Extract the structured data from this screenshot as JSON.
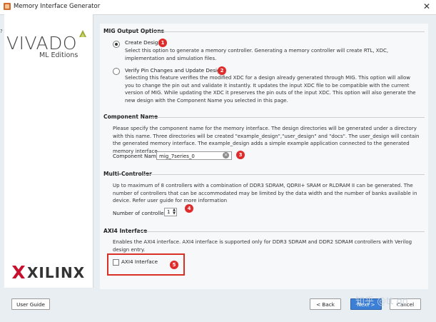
{
  "window": {
    "title": "Memory Interface Generator",
    "close_glyph": "✕"
  },
  "branding": {
    "vivado_word": "VIVADO",
    "ml_editions": "ML Editions",
    "xilinx_word": "XILINX"
  },
  "mig_output": {
    "heading": "MIG Output Options",
    "create": {
      "label": "Create Design",
      "description": "Select this option to generate a memory controller. Generating a memory controller will create RTL, XDC, implementation and simulation files.",
      "selected": true,
      "badge": "1"
    },
    "verify": {
      "label": "Verify Pin Changes and Update Design",
      "description": "Selecting this feature verifies the modified XDC for a design already generated through MIG. This option will allow you to change the pin out and validate it instantly. It updates the input XDC file to be compatible with the current version of MIG. While updating the XDC it preserves the pin outs of the input XDC. This option will also generate the new design with the Component Name you selected in this page.",
      "selected": false,
      "badge": "2"
    }
  },
  "component": {
    "heading": "Component Name",
    "description": "Please specify the component name for the memory interface. The design directories will be generated under a directory with this name. Three directories will be created \"example_design\",\"user_design\" and \"docs\". The user_design will contain the generated memory interface. The example_design adds a simple example application connected to the generated memory interface.",
    "field_label": "Component Name",
    "field_value": "mig_7series_0",
    "badge": "3"
  },
  "multi": {
    "heading": "Multi-Controller",
    "description": "Up to maximum of 8 controllers with a combination of DDR3 SDRAM, QDRII+ SRAM or RLDRAM II can be generated. The number of controllers that can be accommodated may be limited by the data width and the number of banks available in device. Refer user guide for more information",
    "field_label": "Number of controllers",
    "field_value": "1",
    "badge": "4"
  },
  "axi": {
    "heading": "AXI4 Interface",
    "description": "Enables the AXI4 interface. AXI4 interface is supported only for DDR3 SDRAM and DDR2 SDRAM controllers with Verilog design entry.",
    "checkbox_label": "AXI4 Interface",
    "checked": false,
    "badge": "5"
  },
  "footer": {
    "user_guide": "User Guide",
    "back": "< Back",
    "next": "Next >",
    "cancel": "Cancel"
  },
  "watermark": "知乎 @tt go",
  "colors": {
    "badge": "#e02b2b",
    "highlight_box": "#d93025",
    "primary_button": "#3c7fd6"
  }
}
